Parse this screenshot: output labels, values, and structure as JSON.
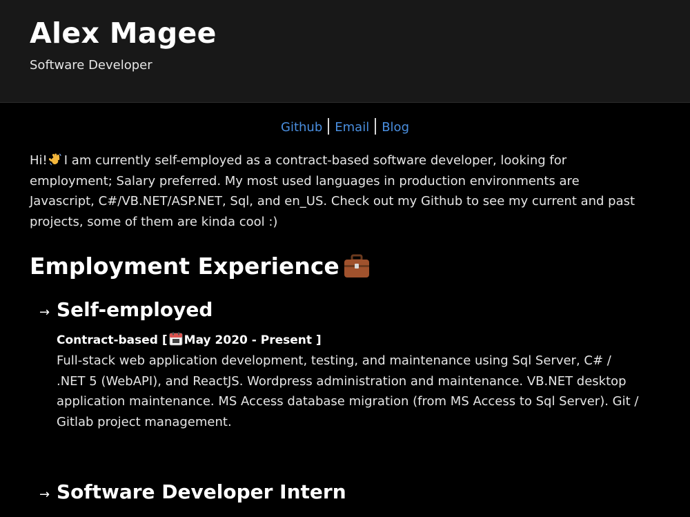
{
  "header": {
    "name": "Alex Magee",
    "role": "Software Developer"
  },
  "links": [
    {
      "label": "Github"
    },
    {
      "label": "Email"
    },
    {
      "label": "Blog"
    }
  ],
  "intro": {
    "greeting": "Hi!",
    "wave_icon": "waving-hand-emoji",
    "text": "I am currently self-employed as a contract-based software developer, looking for employment; Salary preferred. My most used languages in production environments are Javascript, C#/VB.NET/ASP.NET, Sql, and en_US. Check out my Github to see my current and past projects, some of them are kinda cool :)"
  },
  "experience": {
    "title": "Employment Experience",
    "icon": "briefcase-emoji",
    "jobs": [
      {
        "arrow": "→",
        "title": "Self-employed",
        "type": "Contract-based",
        "bracket_open": "[",
        "calendar_icon": "calendar-emoji",
        "dates": "May 2020 - Present ]",
        "description": "Full-stack web application development, testing, and maintenance using Sql Server, C# / .NET 5 (WebAPI), and ReactJS. Wordpress administration and maintenance. VB.NET desktop application maintenance. MS Access database migration (from MS Access to Sql Server). Git / Gitlab project management."
      },
      {
        "arrow": "→",
        "title": "Software Developer Intern"
      }
    ]
  },
  "colors": {
    "background": "#000000",
    "header_background": "#181818",
    "link": "#4a8fe0",
    "text": "#e6e6e6",
    "heading": "#ffffff"
  }
}
